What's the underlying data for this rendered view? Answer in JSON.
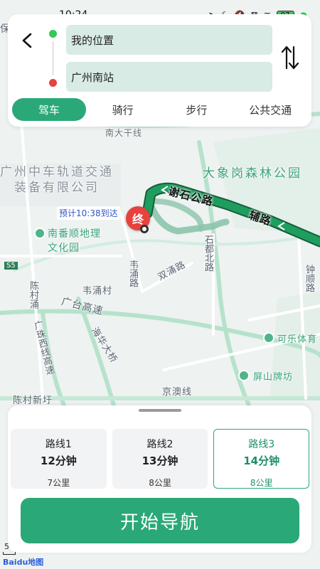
{
  "status_bar": {
    "time": "10:24",
    "battery": "97"
  },
  "search": {
    "back_icon": "back-arrow-icon",
    "from": "我的位置",
    "to": "广州南站",
    "swap_icon": "swap-arrows-icon"
  },
  "modes": [
    {
      "label": "驾车",
      "active": true
    },
    {
      "label": "骑行",
      "active": false
    },
    {
      "label": "步行",
      "active": false
    },
    {
      "label": "公共交通",
      "active": false
    }
  ],
  "map": {
    "labels": {
      "nandaganxian": "南大干线",
      "car_co_1": "广州中车轨道交通",
      "car_co_2": "装备有限公司",
      "forest_park": "大象岗森林公园",
      "xieshi_road": "谢石公路",
      "fu_road": "辅路",
      "eta": "预计10:38到达",
      "nanfan_1": "南番顺地理",
      "nanfan_2": "文化园",
      "shidu_road": "石都北路",
      "weiyong_road": "韦涌路",
      "shuangyong_road": "双涌路",
      "weiyong_village": "韦涌村",
      "chencun_yong": "陈村涌",
      "guangtai_expressway": "广台高速",
      "zhuxi_expressway": "广珠西线高速",
      "haihua_bridge": "海华大桥",
      "zhongshun_road": "钟顺路",
      "kele_sports": "可乐体育",
      "pingshan_paifang": "屏山牌坊",
      "jingao_line": "京澳线",
      "chencun_xinhao": "陈村新圩",
      "end_marker": "终",
      "s5": "S5",
      "edge_bao": "保"
    },
    "colors": {
      "route_active": "#1e9e5e",
      "route_alt": "#8cc4ad",
      "end_marker": "#e8413e"
    }
  },
  "routes": [
    {
      "name": "路线1",
      "time": "12分钟",
      "distance": "7公里",
      "active": false
    },
    {
      "name": "路线2",
      "time": "13分钟",
      "distance": "8公里",
      "active": false
    },
    {
      "name": "路线3",
      "time": "14分钟",
      "distance": "8公里",
      "active": true
    }
  ],
  "start_button": "开始导航",
  "scale": "5",
  "logo": "Baidu地图",
  "accent_color": "#2aa878"
}
